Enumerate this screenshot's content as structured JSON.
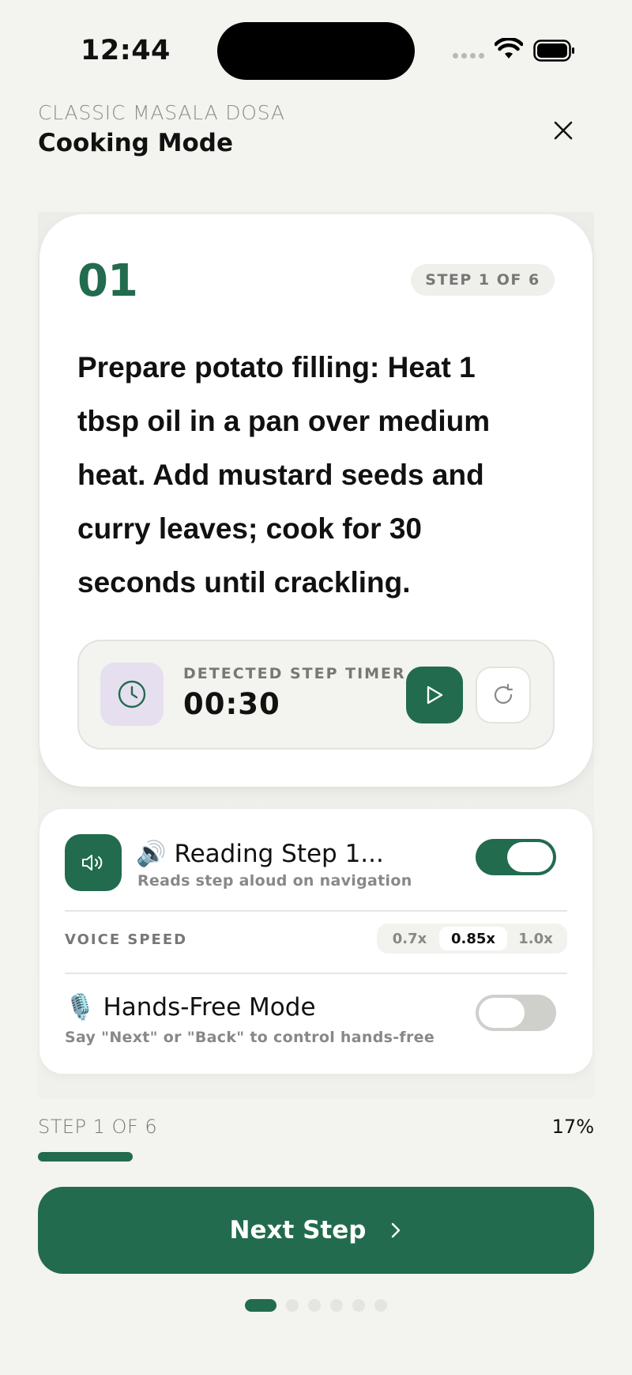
{
  "status_bar": {
    "time": "12:44"
  },
  "header": {
    "recipe_name": "CLASSIC MASALA DOSA",
    "title": "Cooking Mode",
    "close_icon": "close-icon"
  },
  "step": {
    "number": "01",
    "badge": "STEP 1 OF 6",
    "instruction": "Prepare potato filling: Heat 1 tbsp oil in a pan over medium heat. Add mustard seeds and curry leaves; cook for 30 seconds until crackling."
  },
  "timer": {
    "label": "DETECTED STEP TIMER",
    "value": "00:30",
    "icon": "clock-icon",
    "play_icon": "play-icon",
    "reset_icon": "reset-icon"
  },
  "voice": {
    "read_title": "🔊 Reading Step 1...",
    "read_subtitle": "Reads step aloud on navigation",
    "read_enabled": true,
    "speed_label": "VOICE SPEED",
    "speed_options": [
      "0.7x",
      "0.85x",
      "1.0x"
    ],
    "speed_selected": "0.85x",
    "hands_free_title": "🎙️ Hands-Free Mode",
    "hands_free_subtitle": "Say \"Next\" or \"Back\" to control hands-free",
    "hands_free_enabled": false
  },
  "progress": {
    "label": "STEP 1 OF 6",
    "percent_text": "17%",
    "fraction": 0.17
  },
  "next_button": {
    "label": "Next Step",
    "icon": "chevron-right-icon"
  },
  "pagination": {
    "total": 6,
    "current": 1
  },
  "colors": {
    "accent": "#226b4e",
    "background": "#f3f3ef",
    "timer_icon_bg": "#e6dff0"
  }
}
